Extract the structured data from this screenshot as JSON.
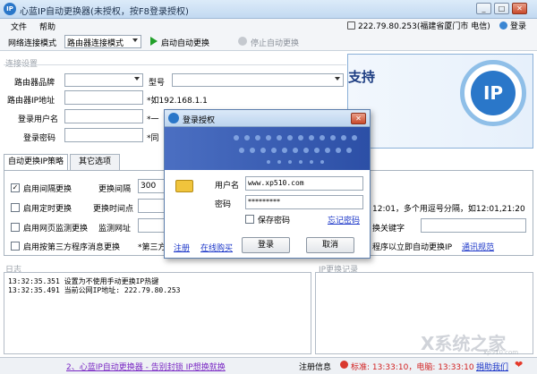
{
  "window": {
    "title": "心蓝IP自动更换器(未授权，按F8登录授权)",
    "logo_text": "IP"
  },
  "menu": {
    "file": "文件",
    "help": "帮助"
  },
  "header": {
    "ip_info": "222.79.80.253(福建省厦门市 电信)",
    "login": "登录"
  },
  "toolbar": {
    "mode_label": "网络连接模式",
    "mode_value": "路由器连接模式",
    "start_auto": "启动自动更换",
    "stop_auto": "停止自动更换"
  },
  "connection": {
    "group_label": "连接设置",
    "brand_label": "路由器品牌",
    "model_label": "型号",
    "ip_label": "路由器IP地址",
    "ip_hint": "*如192.168.1.1",
    "user_label": "登录用户名",
    "user_hint": "*一",
    "pwd_label": "登录密码",
    "pwd_hint": "*同"
  },
  "banner": {
    "support_text": "支持",
    "logo_text": "IP"
  },
  "tabs": {
    "strategy": "自动更换IP策略",
    "other": "其它选项"
  },
  "strategy": {
    "interval_label": "启用间隔更换",
    "interval_field_label": "更换间隔",
    "interval_value": "300",
    "timed_label": "启用定时更换",
    "timepoint_label": "更换时间点",
    "timed_hint": "12:01，多个用逗号分隔，如12:01,21:20",
    "web_label": "启用网页监测更换",
    "web_url_label": "监测网址",
    "web_keyword_hint": "换关键字",
    "third_label": "启用按第三方程序消息更换",
    "third_hint_prefix": "*第三方",
    "third_hint_suffix": "程序以立即自动更换IP",
    "protocol_link": "通讯规范"
  },
  "log": {
    "label": "日志",
    "lines": [
      "13:32:35.351 设置为不使用手动更换IP热键",
      "13:32:35.491 当前公网IP地址: 222.79.80.253"
    ],
    "ip_history_label": "IP更换记录"
  },
  "dialog": {
    "title": "登录授权",
    "username_label": "用户名",
    "username_value": "www.xp510.com",
    "password_label": "密码",
    "password_value": "*********",
    "save_pwd": "保存密码",
    "forgot_pwd": "忘记密码",
    "register": "注册",
    "buy_online": "在线购买",
    "login_btn": "登录",
    "cancel_btn": "取消"
  },
  "statusbar": {
    "ad_link": "2、心蓝IP自动更换器 - 告别封锁 IP想换就换",
    "reg_info": "注册信息",
    "clock": "标准: 13:33:10，电脑: 13:33:10",
    "donate": "捐助我们"
  },
  "watermark": {
    "text": "X系统之家",
    "sub": "xp510.com"
  },
  "colors": {
    "accent": "#2a77c9",
    "status_red": "#d21f1f",
    "link": "#1a35c8"
  }
}
